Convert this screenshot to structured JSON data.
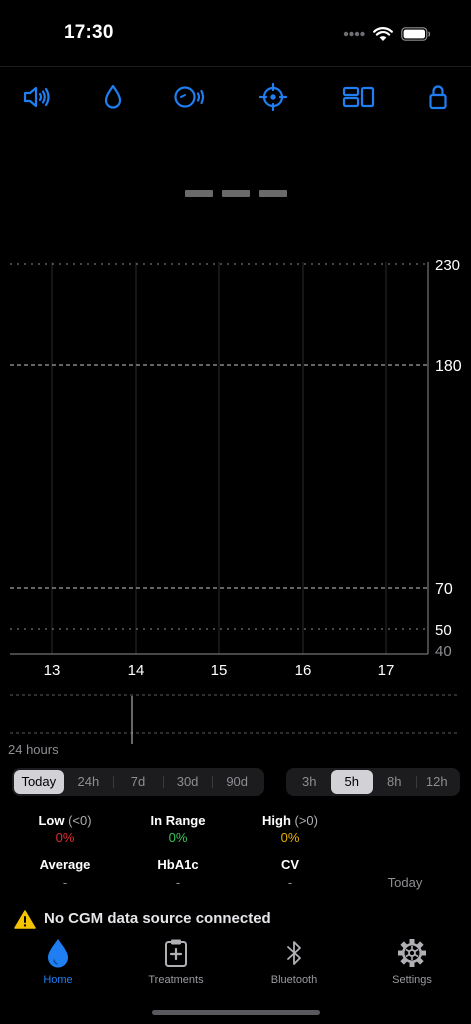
{
  "status_bar": {
    "time": "17:30"
  },
  "toolbar": {
    "buttons": [
      {
        "icon": "speaker-icon"
      },
      {
        "icon": "drop-icon"
      },
      {
        "icon": "sensor-broadcast-icon"
      },
      {
        "icon": "crosshair-icon"
      },
      {
        "icon": "layout-icon"
      },
      {
        "icon": "lock-icon"
      }
    ],
    "accent": "#1e7ef2"
  },
  "reading": {
    "value": "---"
  },
  "chart_data": {
    "type": "line",
    "x_ticks": [
      "13",
      "14",
      "15",
      "16",
      "17"
    ],
    "y_ticks": [
      "230",
      "180",
      "70",
      "50",
      "40"
    ],
    "ylim": [
      40,
      230
    ],
    "threshold_lines": [
      230,
      180,
      70,
      50
    ],
    "series": [],
    "grid": true,
    "high_color": "#e0b000",
    "low_color": "#e02020"
  },
  "overview": {
    "label": "24 hours"
  },
  "range_selector": {
    "options": [
      "Today",
      "24h",
      "7d",
      "30d",
      "90d"
    ],
    "selected": "Today"
  },
  "window_selector": {
    "options": [
      "3h",
      "5h",
      "8h",
      "12h"
    ],
    "selected": "5h"
  },
  "stats": {
    "low": {
      "label": "Low",
      "sub": "(<0)",
      "value": "0%",
      "color": "#e02b2b"
    },
    "in_range": {
      "label": "In Range",
      "value": "0%",
      "color": "#34c759"
    },
    "high": {
      "label": "High",
      "sub": "(>0)",
      "value": "0%",
      "color": "#e6b000"
    },
    "average": {
      "label": "Average",
      "value": "-"
    },
    "hba1c": {
      "label": "HbA1c",
      "value": "-"
    },
    "cv": {
      "label": "CV",
      "value": "-"
    },
    "period": "Today"
  },
  "warning": {
    "text": "No CGM data source connected",
    "color": "#f5c400"
  },
  "tab_bar": {
    "items": [
      {
        "label": "Home",
        "icon": "drop-fill-icon",
        "active": true
      },
      {
        "label": "Treatments",
        "icon": "clipboard-plus-icon",
        "active": false
      },
      {
        "label": "Bluetooth",
        "icon": "bluetooth-icon",
        "active": false
      },
      {
        "label": "Settings",
        "icon": "gear-icon",
        "active": false
      }
    ]
  }
}
